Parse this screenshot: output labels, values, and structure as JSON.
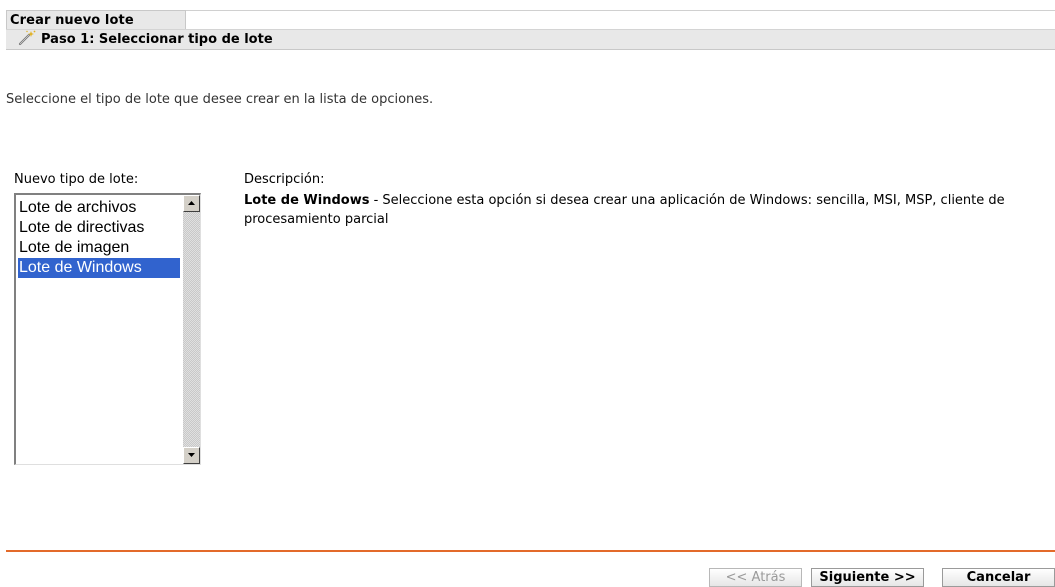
{
  "header": {
    "title": "Crear nuevo lote",
    "step_title": "Paso 1: Seleccionar tipo de lote",
    "step_icon": "wand-icon"
  },
  "instruction": "Seleccione el tipo de lote que desee crear en la lista de opciones.",
  "bundle_type": {
    "label": "Nuevo tipo de lote:",
    "items": [
      {
        "label": "Lote de archivos",
        "selected": false
      },
      {
        "label": "Lote de directivas",
        "selected": false
      },
      {
        "label": "Lote de imagen",
        "selected": false
      },
      {
        "label": "Lote de Windows",
        "selected": true
      }
    ]
  },
  "description": {
    "label": "Descripción:",
    "title": "Lote de Windows",
    "text": " - Seleccione esta opción si desea crear una aplicación de Windows: sencilla, MSI, MSP, cliente de procesamiento parcial"
  },
  "footer": {
    "back_label": "<< Atrás",
    "next_label": "Siguiente >>",
    "cancel_label": "Cancelar"
  },
  "colors": {
    "accent_rule": "#e36a2a",
    "selection": "#3163ce",
    "header_bg": "#e8e8e8"
  }
}
